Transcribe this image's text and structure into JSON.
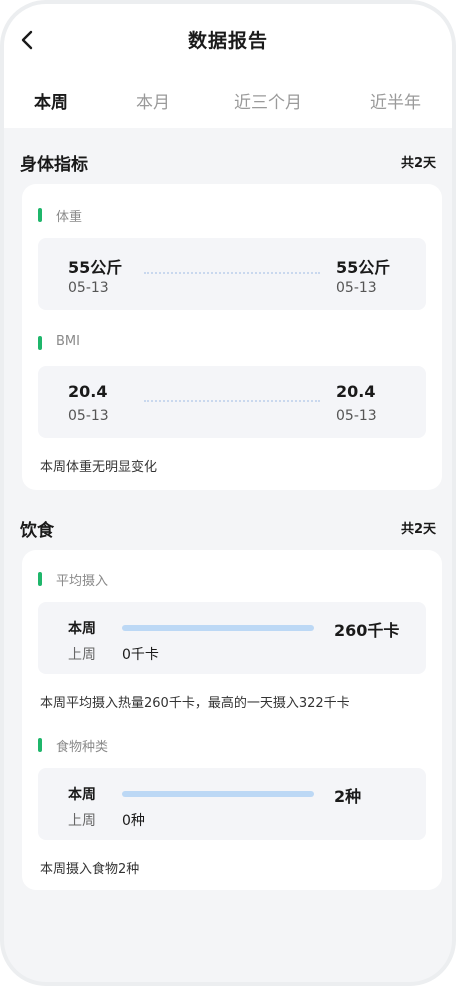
{
  "header": {
    "title": "数据报告"
  },
  "tabs": [
    {
      "label": "本周",
      "active": true
    },
    {
      "label": "本月",
      "active": false
    },
    {
      "label": "近三个月",
      "active": false
    },
    {
      "label": "近半年",
      "active": false
    }
  ],
  "accent_color": "#1fb66b",
  "body_metrics": {
    "title": "身体指标",
    "count": "共2天",
    "weight": {
      "label": "体重",
      "start_value": "55公斤",
      "start_date": "05-13",
      "end_value": "55公斤",
      "end_date": "05-13"
    },
    "bmi": {
      "label": "BMI",
      "start_value": "20.4",
      "start_date": "05-13",
      "end_value": "20.4",
      "end_date": "05-13"
    },
    "summary": "本周体重无明显变化"
  },
  "diet": {
    "title": "饮食",
    "count": "共2天",
    "intake": {
      "label": "平均摄入",
      "this_week_label": "本周",
      "this_week_value": "260千卡",
      "last_week_label": "上周",
      "last_week_value": "0千卡",
      "summary": "本周平均摄入热量260千卡，最高的一天摄入322千卡"
    },
    "food_types": {
      "label": "食物种类",
      "this_week_label": "本周",
      "this_week_value": "2种",
      "last_week_label": "上周",
      "last_week_value": "0种",
      "summary": "本周摄入食物2种"
    }
  }
}
